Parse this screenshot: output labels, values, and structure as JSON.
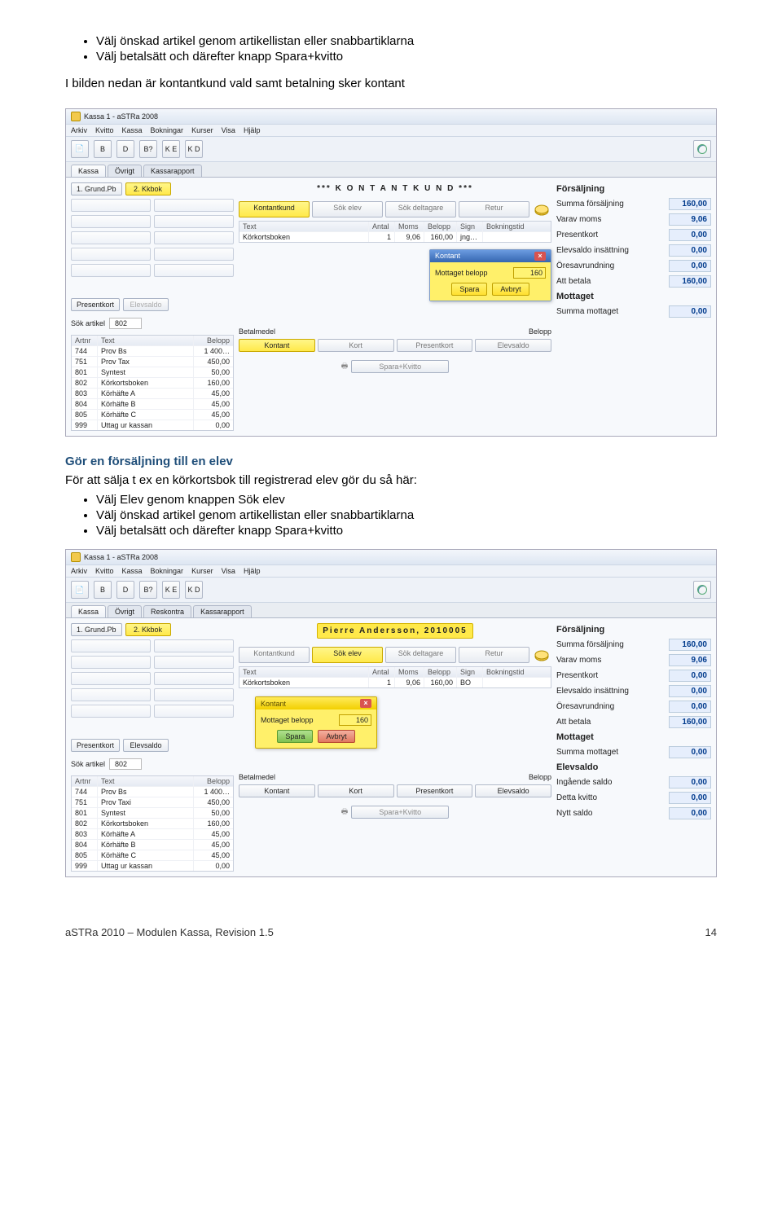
{
  "intro_bullets": [
    "Välj önskad artikel genom artikellistan eller snabbartiklarna",
    "Välj betalsätt och därefter knapp Spara+kvitto"
  ],
  "intro_para": "I bilden nedan är kontantkund vald samt betalning sker kontant",
  "app1": {
    "title": "Kassa 1 - aSTRa 2008",
    "menus": [
      "Arkiv",
      "Kvitto",
      "Kassa",
      "Bokningar",
      "Kurser",
      "Visa",
      "Hjälp"
    ],
    "tabs": [
      "Kassa",
      "Övrigt",
      "Kassarapport"
    ],
    "quick_buttons": [
      "1. Grund.Pb",
      "2. Kkbok"
    ],
    "low_buttons": [
      "Presentkort",
      "Elevsaldo"
    ],
    "header": "*** K O N T A N T K U N D ***",
    "mid_buttons": [
      "Kontantkund",
      "Sök elev",
      "Sök deltagare",
      "Retur"
    ],
    "line_header": [
      "Text",
      "Antal",
      "Moms",
      "Belopp",
      "Sign",
      "Bokningstid"
    ],
    "line_row": [
      "Körkortsboken",
      "1",
      "9,06",
      "160,00",
      "jng…",
      ""
    ],
    "sok_label": "Sök artikel",
    "sok_value": "802",
    "betal_label": "Betalmedel",
    "belopp_label": "Belopp",
    "art_header": [
      "Artnr",
      "Text",
      "Belopp"
    ],
    "articles": [
      [
        "744",
        "Prov Bs",
        "1 400…"
      ],
      [
        "751",
        "Prov Tax",
        "450,00"
      ],
      [
        "801",
        "Syntest",
        "50,00"
      ],
      [
        "802",
        "Körkortsboken",
        "160,00"
      ],
      [
        "803",
        "Körhäfte A",
        "45,00"
      ],
      [
        "804",
        "Körhäfte B",
        "45,00"
      ],
      [
        "805",
        "Körhäfte C",
        "45,00"
      ],
      [
        "999",
        "Uttag ur kassan",
        "0,00"
      ]
    ],
    "dialog": {
      "title": "Kontant",
      "field": "Mottaget belopp",
      "value": "160",
      "spara": "Spara",
      "avbryt": "Avbryt"
    },
    "pay_buttons": [
      "Kontant",
      "Kort",
      "Presentkort",
      "Elevsaldo"
    ],
    "spara_kvitto": "Spara+Kvitto",
    "summary_head1": "Försäljning",
    "summary1": [
      [
        "Summa försäljning",
        "160,00"
      ],
      [
        "Varav moms",
        "9,06"
      ],
      [
        "Presentkort",
        "0,00"
      ],
      [
        "Elevsaldo insättning",
        "0,00"
      ],
      [
        "Öresavrundning",
        "0,00"
      ],
      [
        "Att betala",
        "160,00"
      ]
    ],
    "summary_head2": "Mottaget",
    "summary2": [
      [
        "Summa mottaget",
        "0,00"
      ]
    ]
  },
  "sub_heading": "Gör en försäljning till en elev",
  "sub_para": "För att sälja t ex en körkortsbok till registrerad elev gör du så här:",
  "sub_bullets": [
    "Välj Elev genom knappen Sök elev",
    "Välj önskad artikel genom artikellistan eller snabbartiklarna",
    "Välj betalsätt och därefter knapp Spara+kvitto"
  ],
  "app2": {
    "title": "Kassa 1 - aSTRa 2008",
    "menus": [
      "Arkiv",
      "Kvitto",
      "Kassa",
      "Bokningar",
      "Kurser",
      "Visa",
      "Hjälp"
    ],
    "tabs": [
      "Kassa",
      "Övrigt",
      "Reskontra",
      "Kassarapport"
    ],
    "quick_buttons": [
      "1. Grund.Pb",
      "2. Kkbok"
    ],
    "low_buttons": [
      "Presentkort",
      "Elevsaldo"
    ],
    "header": "Pierre Andersson, 2010005",
    "mid_buttons": [
      "Kontantkund",
      "Sök elev",
      "Sök deltagare",
      "Retur"
    ],
    "line_header": [
      "Text",
      "Antal",
      "Moms",
      "Belopp",
      "Sign",
      "Bokningstid"
    ],
    "line_row": [
      "Körkortsboken",
      "1",
      "9,06",
      "160,00",
      "BO",
      ""
    ],
    "sok_label": "Sök artikel",
    "sok_value": "802",
    "betal_label": "Betalmedel",
    "belopp_label": "Belopp",
    "art_header": [
      "Artnr",
      "Text",
      "Belopp"
    ],
    "articles": [
      [
        "744",
        "Prov Bs",
        "1 400…"
      ],
      [
        "751",
        "Prov Taxi",
        "450,00"
      ],
      [
        "801",
        "Syntest",
        "50,00"
      ],
      [
        "802",
        "Körkortsboken",
        "160,00"
      ],
      [
        "803",
        "Körhäfte A",
        "45,00"
      ],
      [
        "804",
        "Körhäfte B",
        "45,00"
      ],
      [
        "805",
        "Körhäfte C",
        "45,00"
      ],
      [
        "999",
        "Uttag ur kassan",
        "0,00"
      ]
    ],
    "dialog": {
      "title": "Kontant",
      "field": "Mottaget belopp",
      "value": "160",
      "spara": "Spara",
      "avbryt": "Avbryt"
    },
    "pay_buttons": [
      "Kontant",
      "Kort",
      "Presentkort",
      "Elevsaldo"
    ],
    "spara_kvitto": "Spara+Kvitto",
    "summary_head1": "Försäljning",
    "summary1": [
      [
        "Summa försäljning",
        "160,00"
      ],
      [
        "Varav moms",
        "9,06"
      ],
      [
        "Presentkort",
        "0,00"
      ],
      [
        "Elevsaldo insättning",
        "0,00"
      ],
      [
        "Öresavrundning",
        "0,00"
      ],
      [
        "Att betala",
        "160,00"
      ]
    ],
    "summary_head2": "Mottaget",
    "summary2": [
      [
        "Summa mottaget",
        "0,00"
      ]
    ],
    "summary_head3": "Elevsaldo",
    "summary3": [
      [
        "Ingående saldo",
        "0,00"
      ],
      [
        "Detta kvitto",
        "0,00"
      ],
      [
        "Nytt saldo",
        "0,00"
      ]
    ]
  },
  "footer_left": "aSTRa 2010 – Modulen Kassa, Revision 1.5",
  "footer_right": "14"
}
